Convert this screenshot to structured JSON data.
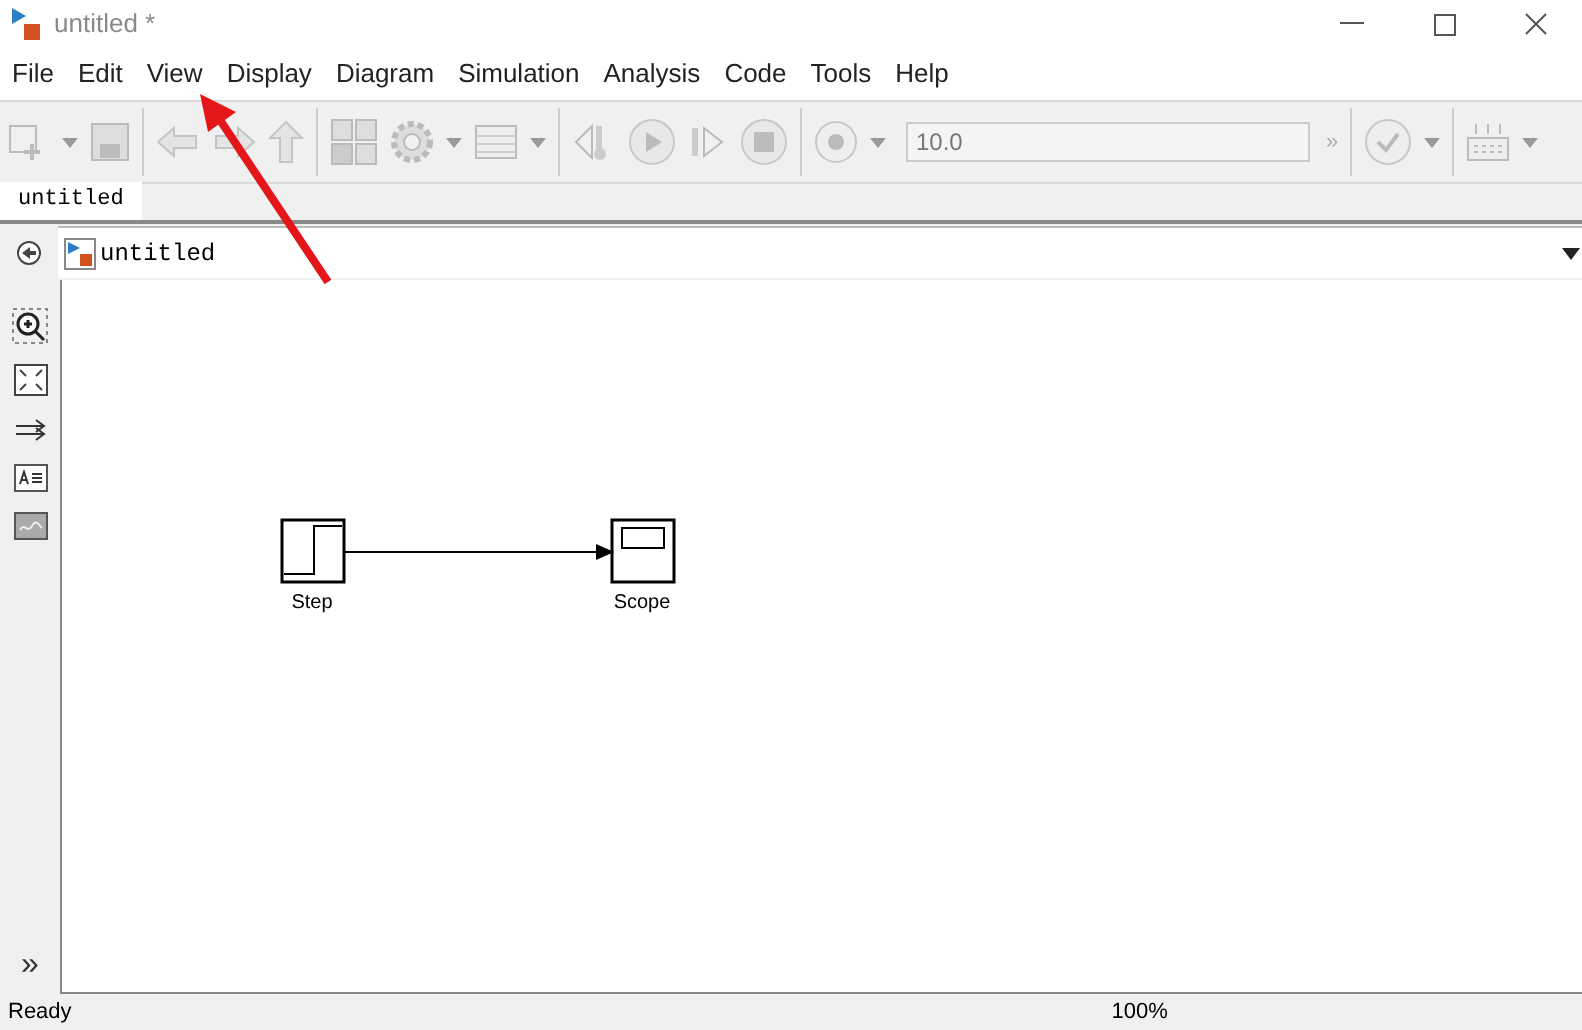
{
  "window": {
    "title": "untitled *"
  },
  "menu": [
    "File",
    "Edit",
    "View",
    "Display",
    "Diagram",
    "Simulation",
    "Analysis",
    "Code",
    "Tools",
    "Help"
  ],
  "toolbar": {
    "stop_time": "10.0",
    "more": "»"
  },
  "tabs": [
    {
      "label": "untitled",
      "selected": true
    }
  ],
  "address": {
    "path": "untitled"
  },
  "palette": {
    "more": "»"
  },
  "diagram": {
    "blocks": [
      {
        "kind": "step",
        "label": "Step"
      },
      {
        "kind": "scope",
        "label": "Scope"
      }
    ]
  },
  "status_bar": {
    "state": "Ready",
    "zoom": "100%"
  }
}
